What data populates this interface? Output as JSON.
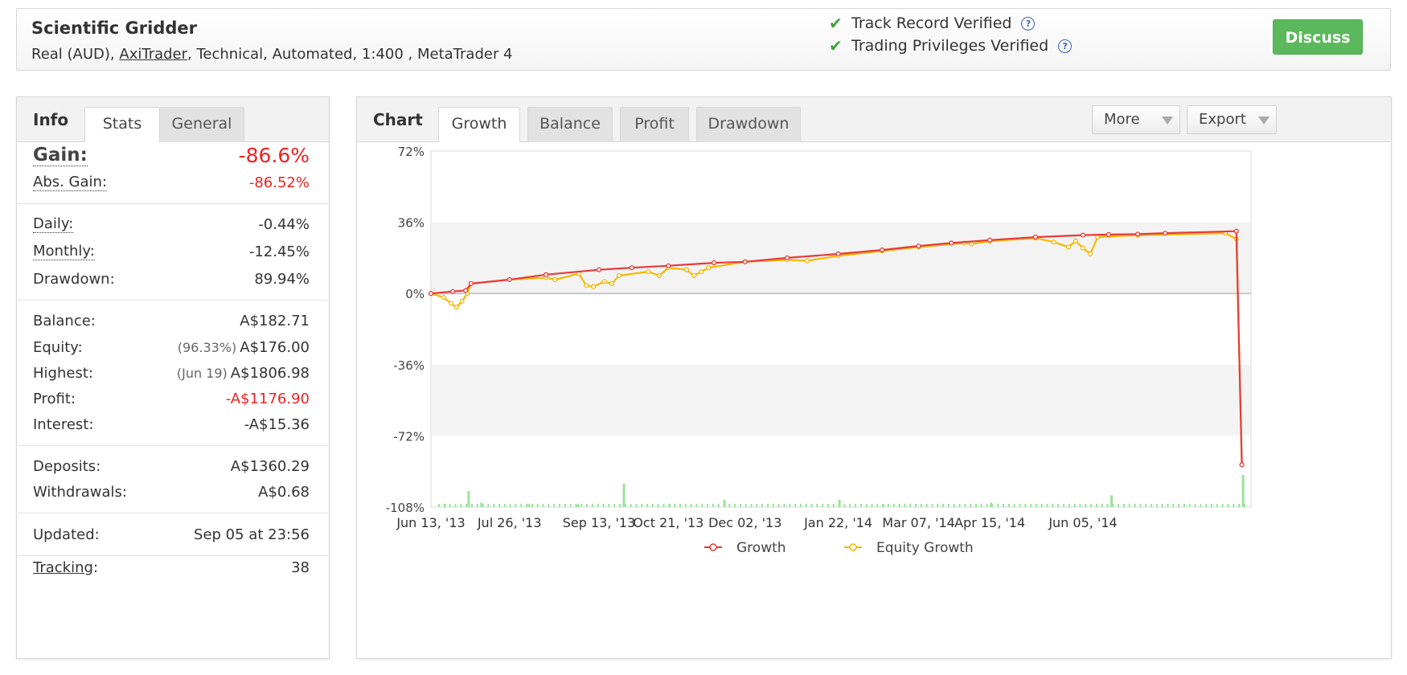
{
  "header": {
    "system_name": "Scientific Gridder",
    "meta_prefix": "Real (AUD), ",
    "broker": "AxiTrader",
    "meta_suffix": ", Technical, Automated, 1:400 , MetaTrader 4",
    "verified": [
      {
        "label": "Track Record Verified"
      },
      {
        "label": "Trading Privileges Verified"
      }
    ],
    "help_glyph": "?",
    "check_glyph": "✔",
    "discuss_label": "Discuss",
    "accent_color": "#5cb85c"
  },
  "info": {
    "title": "Info",
    "tabs": [
      {
        "label": "Stats",
        "active": true
      },
      {
        "label": "General",
        "active": false
      }
    ],
    "gain": {
      "label": "Gain:",
      "value": "-86.6%"
    },
    "abs_gain": {
      "label": "Abs. Gain:",
      "value": "-86.52%"
    },
    "daily": {
      "label": "Daily:",
      "value": "-0.44%"
    },
    "monthly": {
      "label": "Monthly:",
      "value": "-12.45%"
    },
    "drawdown": {
      "label": "Drawdown:",
      "value": "89.94%"
    },
    "balance": {
      "label": "Balance:",
      "value": "A$182.71"
    },
    "equity": {
      "label": "Equity:",
      "sub": "(96.33%)",
      "value": "A$176.00"
    },
    "highest": {
      "label": "Highest:",
      "sub": "(Jun 19)",
      "value": "A$1806.98"
    },
    "profit": {
      "label": "Profit:",
      "value": "-A$1176.90"
    },
    "interest": {
      "label": "Interest:",
      "value": "-A$15.36"
    },
    "deposits": {
      "label": "Deposits:",
      "value": "A$1360.29"
    },
    "withdrawals": {
      "label": "Withdrawals:",
      "value": "A$0.68"
    },
    "updated": {
      "label": "Updated:",
      "value": "Sep 05 at 23:56"
    },
    "tracking": {
      "label": "Tracking",
      "colon": ":",
      "value": "38"
    },
    "negative_color": "#ee2222"
  },
  "chart": {
    "title": "Chart",
    "tabs": [
      {
        "label": "Growth",
        "active": true
      },
      {
        "label": "Balance",
        "active": false
      },
      {
        "label": "Profit",
        "active": false
      },
      {
        "label": "Drawdown",
        "active": false
      }
    ],
    "more_label": "More",
    "export_label": "Export"
  },
  "chart_data": {
    "type": "line",
    "title": "",
    "xlabel": "",
    "ylabel": "",
    "ylim": [
      -108,
      72
    ],
    "y_ticks": [
      "72%",
      "36%",
      "0%",
      "-36%",
      "-72%",
      "-108%"
    ],
    "y_tick_values": [
      72,
      36,
      0,
      -36,
      -72,
      -108
    ],
    "x_ticks": [
      "Jun 13, '13",
      "Jul 26, '13",
      "Sep 13, '13",
      "Oct 21, '13",
      "Dec 02, '13",
      "Jan 22, '14",
      "Mar 07, '14",
      "Apr 15, '14",
      "Jun 05, '14"
    ],
    "x_tick_dates": [
      "2013-06-13",
      "2013-07-26",
      "2013-09-13",
      "2013-10-21",
      "2013-12-02",
      "2014-01-22",
      "2014-03-07",
      "2014-04-15",
      "2014-06-05"
    ],
    "x_range": [
      "2013-06-13",
      "2014-09-05"
    ],
    "legend_position": "bottom",
    "grid": "alternating horizontal bands",
    "series": [
      {
        "name": "Growth",
        "color": "#e83a3a",
        "points": [
          [
            "2013-06-13",
            0
          ],
          [
            "2013-06-25",
            1
          ],
          [
            "2013-07-02",
            1.5
          ],
          [
            "2013-07-05",
            5
          ],
          [
            "2013-07-26",
            7
          ],
          [
            "2013-08-15",
            9.5
          ],
          [
            "2013-09-13",
            12
          ],
          [
            "2013-10-01",
            13
          ],
          [
            "2013-10-21",
            14
          ],
          [
            "2013-11-15",
            15.5
          ],
          [
            "2013-12-02",
            16
          ],
          [
            "2013-12-25",
            18
          ],
          [
            "2014-01-22",
            20
          ],
          [
            "2014-02-15",
            22
          ],
          [
            "2014-03-07",
            24
          ],
          [
            "2014-03-25",
            25.5
          ],
          [
            "2014-04-15",
            27
          ],
          [
            "2014-05-10",
            28.5
          ],
          [
            "2014-06-05",
            29.5
          ],
          [
            "2014-06-19",
            29.8
          ],
          [
            "2014-07-05",
            30
          ],
          [
            "2014-07-20",
            30.5
          ],
          [
            "2014-08-28",
            31.5
          ],
          [
            "2014-08-31",
            -86.6
          ]
        ]
      },
      {
        "name": "Equity Growth",
        "color": "#f5b800",
        "points": [
          [
            "2013-06-13",
            0
          ],
          [
            "2013-06-20",
            -2
          ],
          [
            "2013-06-24",
            -5
          ],
          [
            "2013-06-27",
            -7
          ],
          [
            "2013-06-30",
            -4
          ],
          [
            "2013-07-03",
            0
          ],
          [
            "2013-07-05",
            5
          ],
          [
            "2013-07-26",
            7
          ],
          [
            "2013-08-15",
            8
          ],
          [
            "2013-08-20",
            7
          ],
          [
            "2013-09-02",
            10
          ],
          [
            "2013-09-06",
            4
          ],
          [
            "2013-09-10",
            3.5
          ],
          [
            "2013-09-16",
            6
          ],
          [
            "2013-09-20",
            5
          ],
          [
            "2013-09-24",
            9
          ],
          [
            "2013-10-10",
            11
          ],
          [
            "2013-10-16",
            9
          ],
          [
            "2013-10-21",
            13
          ],
          [
            "2013-10-31",
            12
          ],
          [
            "2013-11-04",
            9
          ],
          [
            "2013-11-08",
            11
          ],
          [
            "2013-11-12",
            13
          ],
          [
            "2013-12-02",
            16
          ],
          [
            "2013-12-25",
            17
          ],
          [
            "2014-01-05",
            16.5
          ],
          [
            "2014-01-22",
            19
          ],
          [
            "2014-02-15",
            21.5
          ],
          [
            "2014-03-07",
            23.5
          ],
          [
            "2014-04-01",
            25.5
          ],
          [
            "2014-04-05",
            25
          ],
          [
            "2014-04-15",
            26.5
          ],
          [
            "2014-05-10",
            28
          ],
          [
            "2014-05-20",
            26
          ],
          [
            "2014-05-28",
            23.5
          ],
          [
            "2014-06-01",
            26.5
          ],
          [
            "2014-06-05",
            23
          ],
          [
            "2014-06-09",
            20
          ],
          [
            "2014-06-13",
            28.5
          ],
          [
            "2014-07-05",
            29.5
          ],
          [
            "2014-08-22",
            30.5
          ],
          [
            "2014-08-28",
            27.5
          ],
          [
            "2014-08-31",
            -86.6
          ]
        ]
      }
    ],
    "volume_bars": {
      "color": "#9be29b",
      "note": "daily trading activity bars along bottom of plot, unscaled",
      "points": [
        [
          "2013-06-20",
          2
        ],
        [
          "2013-07-03",
          11
        ],
        [
          "2013-07-10",
          3
        ],
        [
          "2013-08-05",
          2
        ],
        [
          "2013-09-01",
          2
        ],
        [
          "2013-09-26",
          16
        ],
        [
          "2013-10-21",
          2
        ],
        [
          "2013-11-20",
          5
        ],
        [
          "2014-01-22",
          5
        ],
        [
          "2014-02-15",
          2
        ],
        [
          "2014-04-15",
          3
        ],
        [
          "2014-06-20",
          8
        ],
        [
          "2014-08-31",
          22
        ]
      ]
    }
  }
}
